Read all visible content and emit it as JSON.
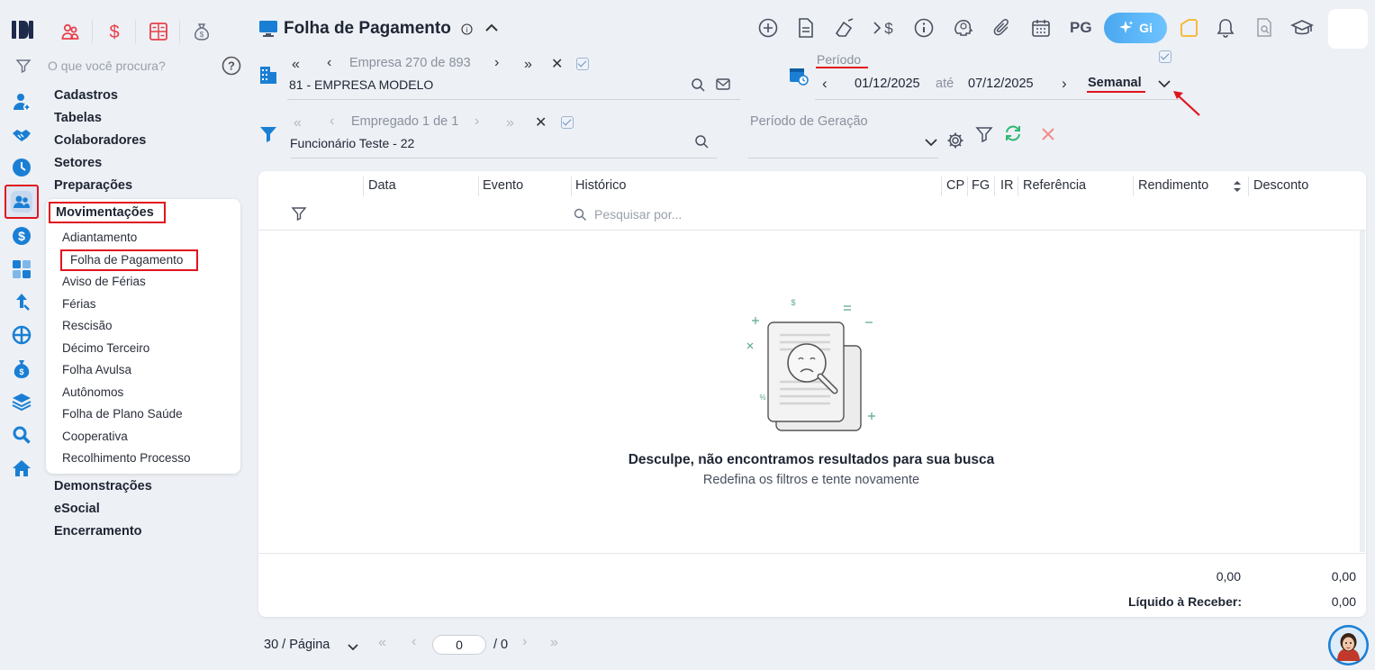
{
  "quick_access": [
    "group-icon",
    "dollar-icon",
    "calculator-icon",
    "money-bag-icon"
  ],
  "search": {
    "placeholder": "O que você procura?"
  },
  "menu": {
    "cadastros": "Cadastros",
    "tabelas": "Tabelas",
    "colaboradores": "Colaboradores",
    "setores": "Setores",
    "preparacoes": "Preparações",
    "movimentacoes": "Movimentações",
    "sub": [
      "Adiantamento",
      "Folha de Pagamento",
      "Aviso de Férias",
      "Férias",
      "Rescisão",
      "Décimo Terceiro",
      "Folha Avulsa",
      "Autônomos",
      "Folha de Plano Saúde",
      "Cooperativa",
      "Recolhimento Processo"
    ],
    "demonstracoes": "Demonstrações",
    "esocial": "eSocial",
    "encerramento": "Encerramento"
  },
  "header": {
    "title": "Folha de Pagamento",
    "pg_label": "PG",
    "gi_label": "Gi"
  },
  "empresa": {
    "label": "Empresa",
    "current": "270",
    "de": "de",
    "total": "893",
    "value": "81 - EMPRESA MODELO"
  },
  "periodo": {
    "label": "Período",
    "start": "01/12/2025",
    "ate": "até",
    "end": "07/12/2025",
    "type": "Semanal"
  },
  "empregado": {
    "label": "Empregado 1 de 1",
    "value": "Funcionário Teste - 22"
  },
  "periodo_geracao": {
    "label": "Período de Geração"
  },
  "table": {
    "columns": {
      "data": "Data",
      "evento": "Evento",
      "historico": "Histórico",
      "cp": "CP",
      "fg": "FG",
      "ir": "IR",
      "referencia": "Referência",
      "rendimento": "Rendimento",
      "desconto": "Desconto"
    },
    "search_placeholder": "Pesquisar por...",
    "empty_title": "Desculpe, não encontramos resultados para sua busca",
    "empty_subtitle": "Redefina os filtros e tente novamente",
    "total_rendimento": "0,00",
    "total_desconto": "0,00",
    "liquido_label": "Líquido à Receber:",
    "liquido_value": "0,00"
  },
  "pagination": {
    "per_page": "30 / Página",
    "current": "0",
    "total": "/ 0"
  },
  "colors": {
    "accent": "#1a7fd4",
    "highlight": "#e0141e",
    "quick_icons": "#e8404a",
    "refresh": "#2eb872"
  }
}
